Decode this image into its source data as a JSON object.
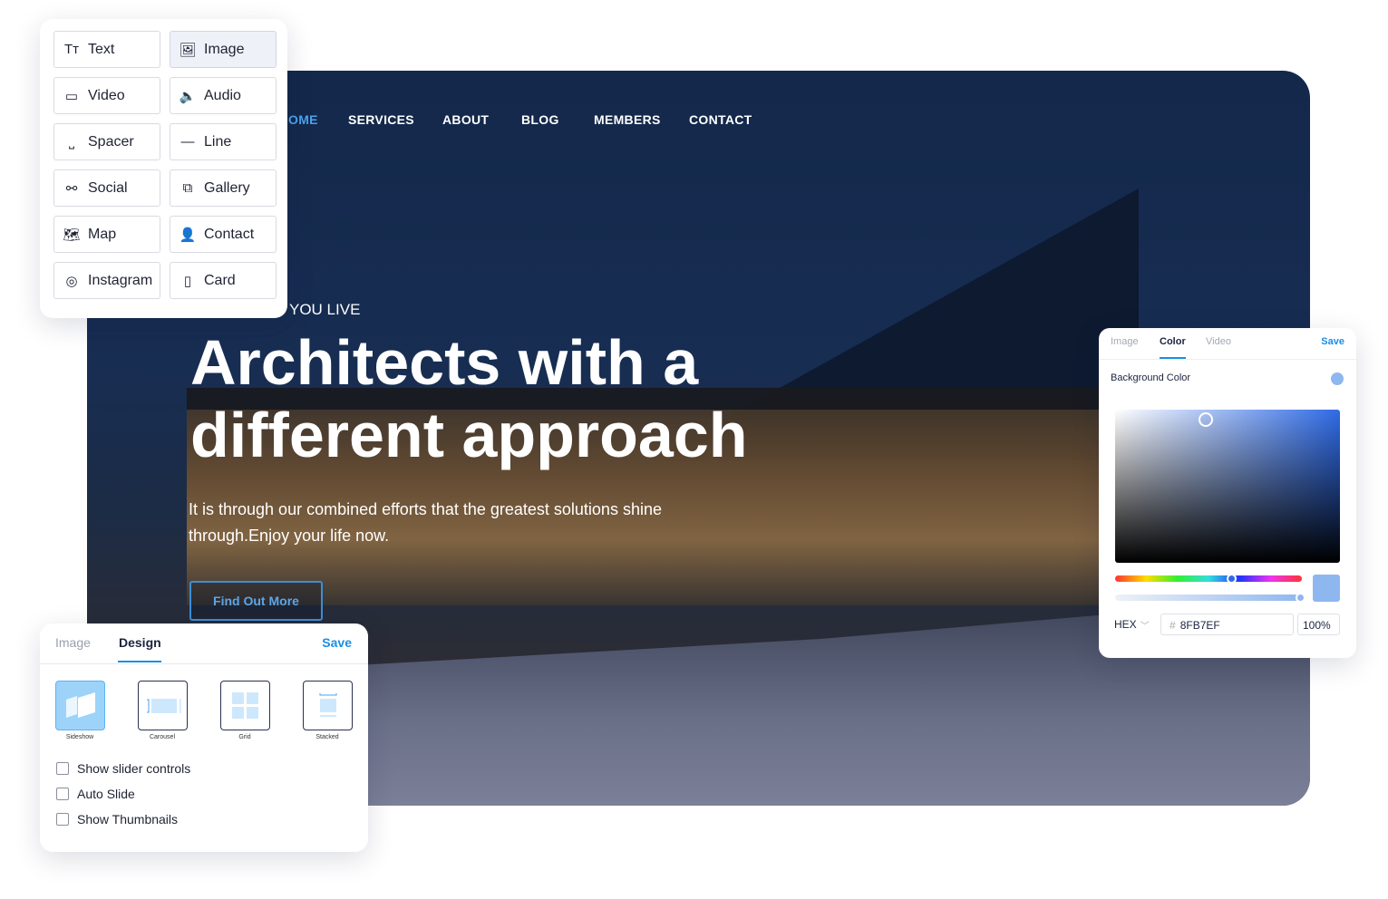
{
  "site": {
    "nav": [
      "OME",
      "SERVICES",
      "ABOUT",
      "BLOG",
      "MEMBERS",
      "CONTACT"
    ],
    "kicker": "YOU LIVE",
    "title_line1": "Architects with a",
    "title_line2": "different approach",
    "subtitle": "It is through our combined efforts that the greatest solutions shine through.Enjoy your life now.",
    "cta": "Find Out More"
  },
  "elements": [
    {
      "label": "Text",
      "icon": "text-icon"
    },
    {
      "label": "Image",
      "icon": "image-icon",
      "active": true
    },
    {
      "label": "Video",
      "icon": "video-icon"
    },
    {
      "label": "Audio",
      "icon": "audio-icon"
    },
    {
      "label": "Spacer",
      "icon": "spacer-icon"
    },
    {
      "label": "Line",
      "icon": "line-icon"
    },
    {
      "label": "Social",
      "icon": "share-icon"
    },
    {
      "label": "Gallery",
      "icon": "gallery-icon"
    },
    {
      "label": "Map",
      "icon": "map-icon"
    },
    {
      "label": "Contact",
      "icon": "contact-icon"
    },
    {
      "label": "Instagram",
      "icon": "instagram-icon"
    },
    {
      "label": "Card",
      "icon": "card-icon"
    }
  ],
  "design_panel": {
    "tabs": [
      "Image",
      "Design"
    ],
    "active_tab": "Design",
    "save": "Save",
    "layouts": [
      "Sideshow",
      "Carousel",
      "Grid",
      "Stacked"
    ],
    "selected_layout": "Sideshow",
    "options": [
      {
        "label": "Show slider controls",
        "checked": false
      },
      {
        "label": "Auto Slide",
        "checked": false
      },
      {
        "label": "Show Thumbnails",
        "checked": false
      }
    ]
  },
  "color_panel": {
    "tabs": [
      "Image",
      "Color",
      "Video"
    ],
    "active_tab": "Color",
    "save": "Save",
    "label": "Background Color",
    "format": "HEX",
    "hex_prefix": "#",
    "hex": "8FB7EF",
    "opacity": "100%",
    "color": "#8FB7EF",
    "hue_position": 0.62,
    "alpha": 1.0
  }
}
